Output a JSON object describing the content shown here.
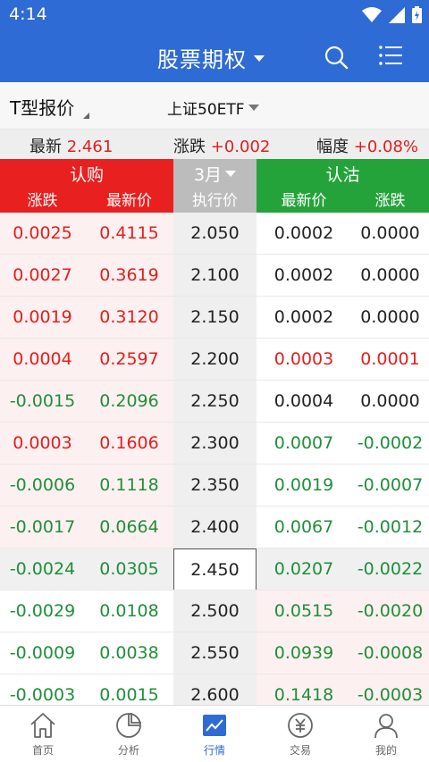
{
  "status_bar": {
    "time": "4:14"
  },
  "header": {
    "title": "股票期权"
  },
  "selector": {
    "board_type": "T型报价",
    "underlying": "上证50ETF"
  },
  "quote": {
    "latest_label": "最新",
    "latest_value": "2.461",
    "change_label": "涨跌",
    "change_value": "+0.002",
    "pct_label": "幅度",
    "pct_value": "+0.08%"
  },
  "columns": {
    "call_title": "认购",
    "put_title": "认沽",
    "month": "3月",
    "strike": "执行价",
    "change": "涨跌",
    "last": "最新价"
  },
  "rows": [
    {
      "call_chg": "0.0025",
      "call_last": "0.4115",
      "strike": "2.050",
      "put_last": "0.0002",
      "put_chg": "0.0000",
      "cc": "up",
      "pc": "flat",
      "call_itm": true,
      "put_itm": false
    },
    {
      "call_chg": "0.0027",
      "call_last": "0.3619",
      "strike": "2.100",
      "put_last": "0.0002",
      "put_chg": "0.0000",
      "cc": "up",
      "pc": "flat",
      "call_itm": true,
      "put_itm": false
    },
    {
      "call_chg": "0.0019",
      "call_last": "0.3120",
      "strike": "2.150",
      "put_last": "0.0002",
      "put_chg": "0.0000",
      "cc": "up",
      "pc": "flat",
      "call_itm": true,
      "put_itm": false
    },
    {
      "call_chg": "0.0004",
      "call_last": "0.2597",
      "strike": "2.200",
      "put_last": "0.0003",
      "put_chg": "0.0001",
      "cc": "up",
      "pc": "up",
      "call_itm": true,
      "put_itm": false
    },
    {
      "call_chg": "-0.0015",
      "call_last": "0.2096",
      "strike": "2.250",
      "put_last": "0.0004",
      "put_chg": "0.0000",
      "cc": "down",
      "pc": "flat",
      "call_itm": true,
      "put_itm": false
    },
    {
      "call_chg": "0.0003",
      "call_last": "0.1606",
      "strike": "2.300",
      "put_last": "0.0007",
      "put_chg": "-0.0002",
      "cc": "up",
      "pc": "down",
      "call_itm": true,
      "put_itm": false
    },
    {
      "call_chg": "-0.0006",
      "call_last": "0.1118",
      "strike": "2.350",
      "put_last": "0.0019",
      "put_chg": "-0.0007",
      "cc": "down",
      "pc": "down",
      "call_itm": true,
      "put_itm": false
    },
    {
      "call_chg": "-0.0017",
      "call_last": "0.0664",
      "strike": "2.400",
      "put_last": "0.0067",
      "put_chg": "-0.0012",
      "cc": "down",
      "pc": "down",
      "call_itm": true,
      "put_itm": false
    },
    {
      "call_chg": "-0.0024",
      "call_last": "0.0305",
      "strike": "2.450",
      "put_last": "0.0207",
      "put_chg": "-0.0022",
      "cc": "down",
      "pc": "down",
      "call_itm": false,
      "put_itm": false,
      "atm": true
    },
    {
      "call_chg": "-0.0029",
      "call_last": "0.0108",
      "strike": "2.500",
      "put_last": "0.0515",
      "put_chg": "-0.0020",
      "cc": "down",
      "pc": "down",
      "call_itm": false,
      "put_itm": true
    },
    {
      "call_chg": "-0.0009",
      "call_last": "0.0038",
      "strike": "2.550",
      "put_last": "0.0939",
      "put_chg": "-0.0008",
      "cc": "down",
      "pc": "down",
      "call_itm": false,
      "put_itm": true
    },
    {
      "call_chg": "-0.0003",
      "call_last": "0.0015",
      "strike": "2.600",
      "put_last": "0.1418",
      "put_chg": "-0.0003",
      "cc": "down",
      "pc": "down",
      "call_itm": false,
      "put_itm": true
    }
  ],
  "bottom_nav": [
    {
      "label": "首页",
      "icon": "home-icon"
    },
    {
      "label": "分析",
      "icon": "pie-chart-icon"
    },
    {
      "label": "行情",
      "icon": "market-chart-icon",
      "active": true
    },
    {
      "label": "交易",
      "icon": "yuan-coin-icon"
    },
    {
      "label": "我的",
      "icon": "user-icon"
    }
  ],
  "colors": {
    "brand_blue": "#2f6bd4",
    "call_red": "#e8201f",
    "put_green": "#24a33b",
    "up_red": "#e0201e",
    "down_green": "#1f8f3a",
    "call_itm_bg": "#fdf0f0",
    "put_itm_bg": "#fdf0f0",
    "otm_bg": "#ffffff",
    "atm_row_bg": "#f0f0f0",
    "nav_active": "#2f6bd4"
  }
}
